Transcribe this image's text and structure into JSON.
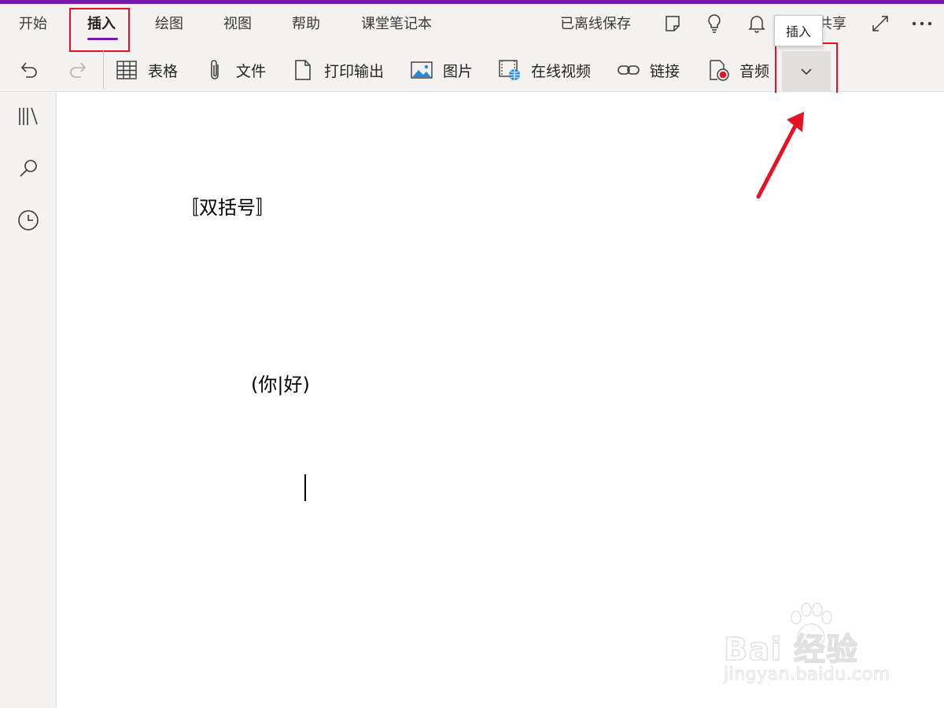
{
  "ribbon": {
    "tabs": [
      {
        "label": "开始"
      },
      {
        "label": "插入"
      },
      {
        "label": "绘图"
      },
      {
        "label": "视图"
      },
      {
        "label": "帮助"
      },
      {
        "label": "课堂笔记本"
      }
    ],
    "saved_status": "已离线保存",
    "share_label": "共享",
    "tooltip": "插入",
    "commands": [
      {
        "label": "表格",
        "icon": "table-icon"
      },
      {
        "label": "文件",
        "icon": "paperclip-icon"
      },
      {
        "label": "打印输出",
        "icon": "document-icon"
      },
      {
        "label": "图片",
        "icon": "picture-icon"
      },
      {
        "label": "在线视频",
        "icon": "online-video-icon"
      },
      {
        "label": "链接",
        "icon": "link-icon"
      },
      {
        "label": "音频",
        "icon": "audio-icon"
      }
    ]
  },
  "page": {
    "line1": "〚双括号〛",
    "line2": "(你|好)"
  },
  "watermark": {
    "brand": "Bai 经验",
    "url": "jingyan.baidu.com"
  },
  "colors": {
    "accent": "#7719aa",
    "highlight": "#e81123",
    "ribbon_bg": "#f3f2f1"
  }
}
